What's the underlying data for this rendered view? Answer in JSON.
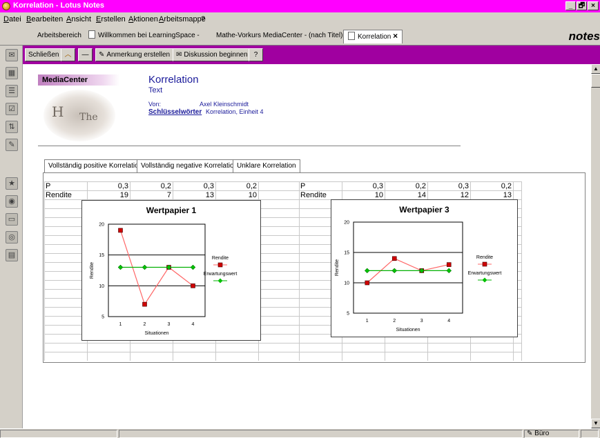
{
  "window": {
    "title": "Korrelation - Lotus Notes",
    "controls": [
      "_",
      "🗗",
      "×"
    ]
  },
  "menu": [
    "Datei",
    "Bearbeiten",
    "Ansicht",
    "Erstellen",
    "Aktionen",
    "Arbeitsmappe",
    "?"
  ],
  "tabs": [
    {
      "label": "Arbeitsbereich"
    },
    {
      "label": "Willkommen bei LearningSpace -"
    },
    {
      "label": "Mathe-Vorkurs MediaCenter - (nach Titel)"
    },
    {
      "label": "Korrelation",
      "close": "×"
    }
  ],
  "brand": "notes",
  "actions": {
    "close": "Schließen",
    "annotate": "Anmerkung erstellen",
    "discussion": "Diskussion beginnen"
  },
  "logo": {
    "text": "MediaCenter",
    "paper_text_1": "H",
    "paper_text_2": "The"
  },
  "document": {
    "title": "Korrelation",
    "subtitle": "Text",
    "from_label": "Von:",
    "from_value": "Axel Kleinschmidt",
    "keywords_label": "Schlüsselwörter",
    "keywords_value": "Korrelation, Einheit 4"
  },
  "content_tabs": [
    {
      "label": "Vollständig positive Korrelation"
    },
    {
      "label": "Vollständig negative Korrelation"
    },
    {
      "label": "Unklare Korrelation"
    }
  ],
  "tables": [
    {
      "p_label": "P",
      "p_values": [
        "0,3",
        "0,2",
        "0,3",
        "0,2"
      ],
      "r_label": "Rendite",
      "r_values": [
        "19",
        "7",
        "13",
        "10"
      ]
    },
    {
      "p_label": "P",
      "p_values": [
        "0,3",
        "0,2",
        "0,3",
        "0,2"
      ],
      "r_label": "Rendite",
      "r_values": [
        "10",
        "14",
        "12",
        "13"
      ]
    }
  ],
  "status": {
    "location": "Büro"
  },
  "colors": {
    "titlebar": "#ff00ff",
    "actionbar": "#a000a0",
    "series_rendite": "#ff6666",
    "series_erwartung": "#00b000"
  },
  "chart_data": [
    {
      "type": "line",
      "title": "Wertpapier 1",
      "xlabel": "Situationen",
      "ylabel": "Rendite",
      "x": [
        1,
        2,
        3,
        4
      ],
      "ylim": [
        5,
        20
      ],
      "yticks": [
        5,
        10,
        15,
        20
      ],
      "grid": true,
      "legend": "right",
      "series": [
        {
          "name": "Rendite",
          "values": [
            19,
            7,
            13,
            10
          ],
          "color": "#ff6666",
          "marker": "square-red"
        },
        {
          "name": "Erwartungswert",
          "values": [
            13,
            13,
            13,
            13
          ],
          "color": "#00b000",
          "marker": "diamond-green"
        }
      ]
    },
    {
      "type": "line",
      "title": "Wertpapier 3",
      "xlabel": "Situationen",
      "ylabel": "Rendite",
      "x": [
        1,
        2,
        3,
        4
      ],
      "ylim": [
        5,
        20
      ],
      "yticks": [
        5,
        10,
        15,
        20
      ],
      "grid": true,
      "legend": "right",
      "series": [
        {
          "name": "Rendite",
          "values": [
            10,
            14,
            12,
            13
          ],
          "color": "#ff6666",
          "marker": "square-red"
        },
        {
          "name": "Erwartungswert",
          "values": [
            12,
            12,
            12,
            12
          ],
          "color": "#00b000",
          "marker": "diamond-green"
        }
      ]
    }
  ]
}
